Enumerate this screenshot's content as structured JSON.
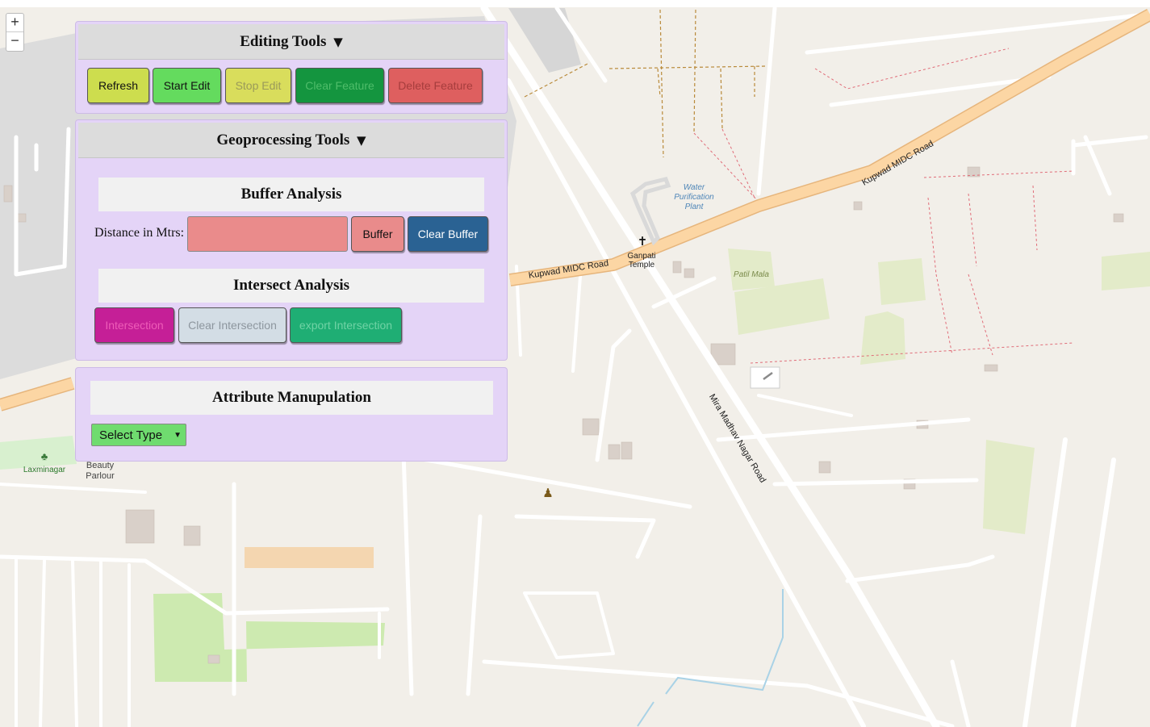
{
  "zoom": {
    "in_label": "+",
    "out_label": "−"
  },
  "editing": {
    "title": "Editing Tools",
    "toggle": "▼",
    "buttons": {
      "refresh": "Refresh",
      "start_edit": "Start Edit",
      "stop_edit": "Stop Edit",
      "clear_feature": "Clear Feature",
      "delete_feature": "Delete Feature"
    }
  },
  "geoprocessing": {
    "title": "Geoprocessing Tools",
    "toggle": "▼",
    "buffer": {
      "title": "Buffer Analysis",
      "distance_label": "Distance in Mtrs:",
      "distance_value": "",
      "buffer_button": "Buffer",
      "clear_button": "Clear Buffer"
    },
    "intersect": {
      "title": "Intersect Analysis",
      "intersection_button": "Intersection",
      "clear_button": "Clear Intersection",
      "export_button": "export Intersection"
    }
  },
  "attribute": {
    "title": "Attribute Manupulation",
    "select_value": "Select Type"
  },
  "map_labels": {
    "road_1": "Kupwad MIDC Road",
    "road_2": "Kupwad MIDC Road",
    "road_3": "Mira Madhav Nagar Road",
    "water_plant": [
      "Water",
      "Purification",
      "Plant"
    ],
    "temple": [
      "Ganpati",
      "Temple"
    ],
    "patil_mala": "Patil Mala",
    "laxminagar": "Laxminagar",
    "parlour": [
      "Beauty",
      "Parlour"
    ]
  },
  "colors": {
    "panel_bg": "#e4d4f7",
    "refresh": "#cddd4e",
    "start_edit": "#64db5e",
    "stop_edit": "#d9dd5c",
    "clear_feature": "#14953f",
    "delete_feature": "#de5f5f",
    "distance_input": "#ea8b8b",
    "buffer": "#e98b8b",
    "clear_buffer": "#2a6293",
    "intersection": "#c51f97",
    "clear_intersection": "#d3dde5",
    "export_intersection": "#1fae74",
    "select": "#6fdc6f"
  }
}
